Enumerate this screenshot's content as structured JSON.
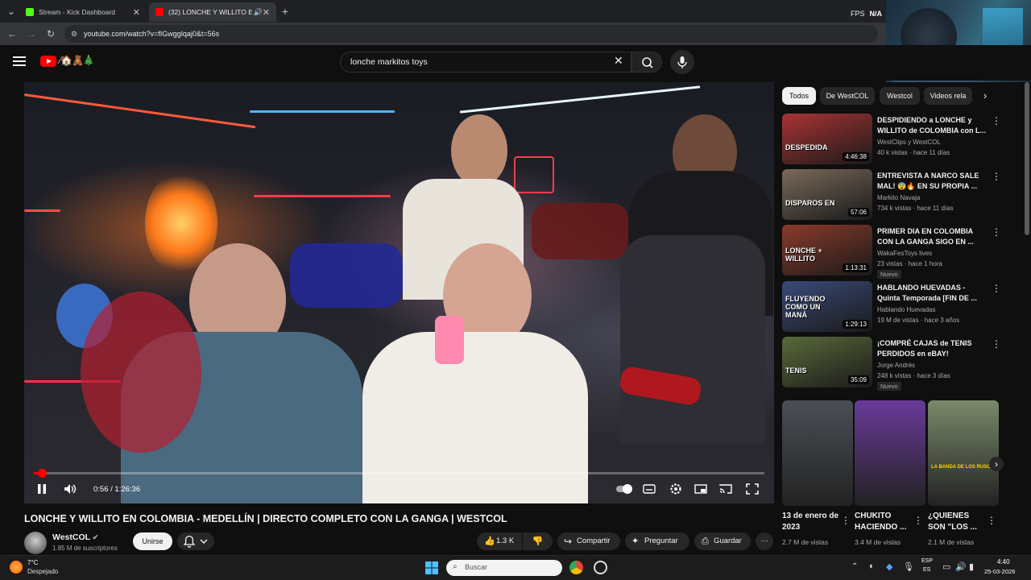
{
  "browser": {
    "tabs": [
      {
        "label": "Stream - Kick Dashboard",
        "color": "#53fc18"
      },
      {
        "label": "(32) LONCHE Y WILLITO EN",
        "color": "#ff0000"
      }
    ],
    "url": "youtube.com/watch?v=fIGwgglqaj0&t=56s",
    "fps_label": "FPS",
    "fps_value": "N/A"
  },
  "youtube": {
    "search_value": "lonche markitos toys",
    "doodle": "⁄🏠🧸🎄"
  },
  "player": {
    "time": "0:56 / 1:26:36",
    "progress_fraction": 0.0108
  },
  "video": {
    "title": "LONCHE Y WILLITO EN COLOMBIA - MEDELLÍN | DIRECTO COMPLETO CON LA GANGA | WESTCOL",
    "channel": "WestCOL",
    "subscribers": "1.85 M de suscriptores",
    "join_label": "Unirse",
    "likes": "1.3 K",
    "share_label": "Compartir",
    "ask_label": "Preguntar",
    "save_label": "Guardar",
    "more_label": "···"
  },
  "chips": [
    "Todos",
    "De WestCOL",
    "Westcol",
    "Videos rela"
  ],
  "recommendations": [
    {
      "title": "DESPIDIENDO a LONCHE y WILLITO de COLOMBIA con L...",
      "channel": "WestClips y WestCOL",
      "meta": "40 k vistas · hace 11 días",
      "duration": "4:46:38",
      "badge": "",
      "thumb_text": "DESPEDIDA",
      "thumb_color": "#a33"
    },
    {
      "title": "ENTREVISTA A NARCO SALE MAL! 😨🔥 EN SU PROPIA ...",
      "channel": "Markito Navaja",
      "meta": "734 k vistas · hace 11 días",
      "duration": "57:06",
      "badge": "",
      "thumb_text": "DISPAROS EN",
      "thumb_color": "#7a6a5a"
    },
    {
      "title": "PRIMER DIA EN COLOMBIA CON LA GANGA SIGO EN ...",
      "channel": "WakaFesToys lives",
      "meta": "23 vistas · hace 1 hora",
      "duration": "1:13:31",
      "badge": "Nuevo",
      "thumb_text": "LONCHE + WILLITO",
      "thumb_color": "#8a3a2a"
    },
    {
      "title": "HABLANDO HUEVADAS - Quinta Temporada [FIN DE ...",
      "channel": "Hablando Huevadas",
      "meta": "19 M de vistas · hace 3 años",
      "duration": "1:29:13",
      "badge": "",
      "thumb_text": "FLUYENDO COMO UN MANÁ",
      "thumb_color": "#3a4a7a"
    },
    {
      "title": "¡COMPRÉ CAJAS de TENIS PERDIDOS en eBAY!",
      "channel": "Jorge Andrés",
      "meta": "248 k vistas · hace 3 días",
      "duration": "35:09",
      "badge": "Nuevo",
      "thumb_text": "TENIS",
      "thumb_color": "#5a6a3a"
    }
  ],
  "shorts": [
    {
      "title": "13 de enero de 2023",
      "views": "2.7 M de vistas",
      "color": "#4a4f55"
    },
    {
      "title": "CHUKITO HACIENDO ...",
      "views": "3.4 M de vistas",
      "color": "#6a3a9a"
    },
    {
      "title": "¿QUIENES SON \"LOS ...",
      "views": "2.1 M de vistas",
      "color": "#7a8a6a",
      "caption": "LA BANDA DE LOS RUSOS"
    }
  ],
  "taskbar": {
    "weather_temp": "7°C",
    "weather_text": "Despejado",
    "search_placeholder": "Buscar",
    "lang_top": "ESP",
    "lang_bottom": "ES",
    "time": "4:40",
    "date": "25-03-2026"
  },
  "colors": {
    "accent": "#ff0000",
    "bg": "#0f0f0f"
  }
}
